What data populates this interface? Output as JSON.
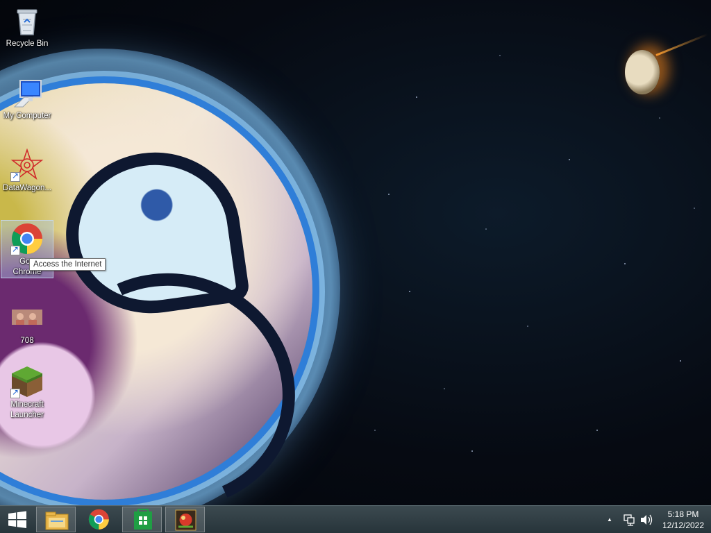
{
  "desktop": {
    "icons": [
      {
        "label": "Recycle Bin"
      },
      {
        "label": "My Computer"
      },
      {
        "label": "DataWagon..."
      },
      {
        "label": "Google Chrome",
        "visible_label_line1": "Goo",
        "visible_label_line2": "Chrome"
      },
      {
        "label": "708"
      },
      {
        "label": "Minecraft Launcher"
      }
    ]
  },
  "tooltip": {
    "text": "Access the Internet"
  },
  "taskbar": {
    "pinned": [
      {
        "name": "file-explorer"
      },
      {
        "name": "google-chrome"
      },
      {
        "name": "windows-store"
      },
      {
        "name": "app"
      }
    ],
    "tray": {
      "show_hidden": "▲"
    },
    "clock": {
      "time": "5:18 PM",
      "date": "12/12/2022"
    }
  },
  "colors": {
    "taskbar_bg": "#2f3c42",
    "accent": "#1a73e8",
    "selection": "#adc8e6"
  }
}
